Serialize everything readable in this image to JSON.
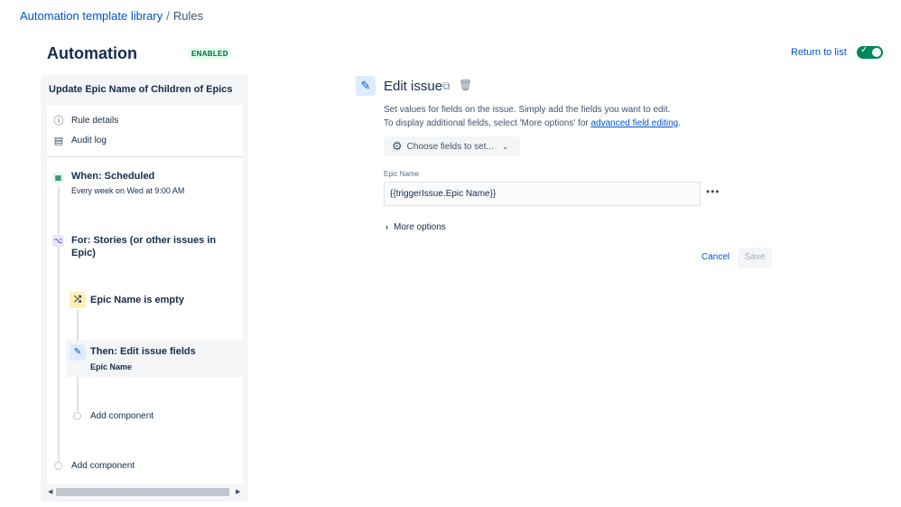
{
  "breadcrumb": {
    "library": "Automation template library",
    "separator": "/",
    "current": "Rules"
  },
  "header": {
    "title": "Automation",
    "status": "ENABLED",
    "return_link": "Return to list",
    "toggle_on": true
  },
  "sidebar": {
    "rule_name": "Update Epic Name of Children of Epics",
    "nav": [
      {
        "label": "Rule details",
        "icon": "info-icon"
      },
      {
        "label": "Audit log",
        "icon": "document-icon"
      }
    ],
    "components": {
      "trigger": {
        "title": "When: Scheduled",
        "subtitle": "Every week on Wed at 9:00 AM",
        "icon": "calendar-icon"
      },
      "branch": {
        "title": "For: Stories (or other issues in Epic)",
        "icon": "hierarchy-icon"
      },
      "condition": {
        "title": "Epic Name is empty",
        "icon": "shuffle-icon"
      },
      "action": {
        "title": "Then: Edit issue fields",
        "subtitle": "Epic Name",
        "icon": "pencil-icon"
      }
    },
    "add_component_inner": "Add component",
    "add_component_outer": "Add component"
  },
  "editor": {
    "title": "Edit issue",
    "desc_line1": "Set values for fields on the issue. Simply add the fields you want to edit.",
    "desc_line2_prefix": "To display additional fields, select 'More options' for ",
    "desc_link": "advanced field editing",
    "desc_line2_suffix": ".",
    "choose_fields": "Choose fields to set...",
    "field_label": "Epic Name",
    "field_value": "{{triggerIssue.Epic Name}}",
    "more_options": "More options",
    "cancel": "Cancel",
    "save": "Save"
  },
  "colors": {
    "accent": "#0052cc",
    "enabled_green": "#00875a",
    "lozenge_bg": "#e3fcef",
    "lozenge_text": "#006644"
  }
}
